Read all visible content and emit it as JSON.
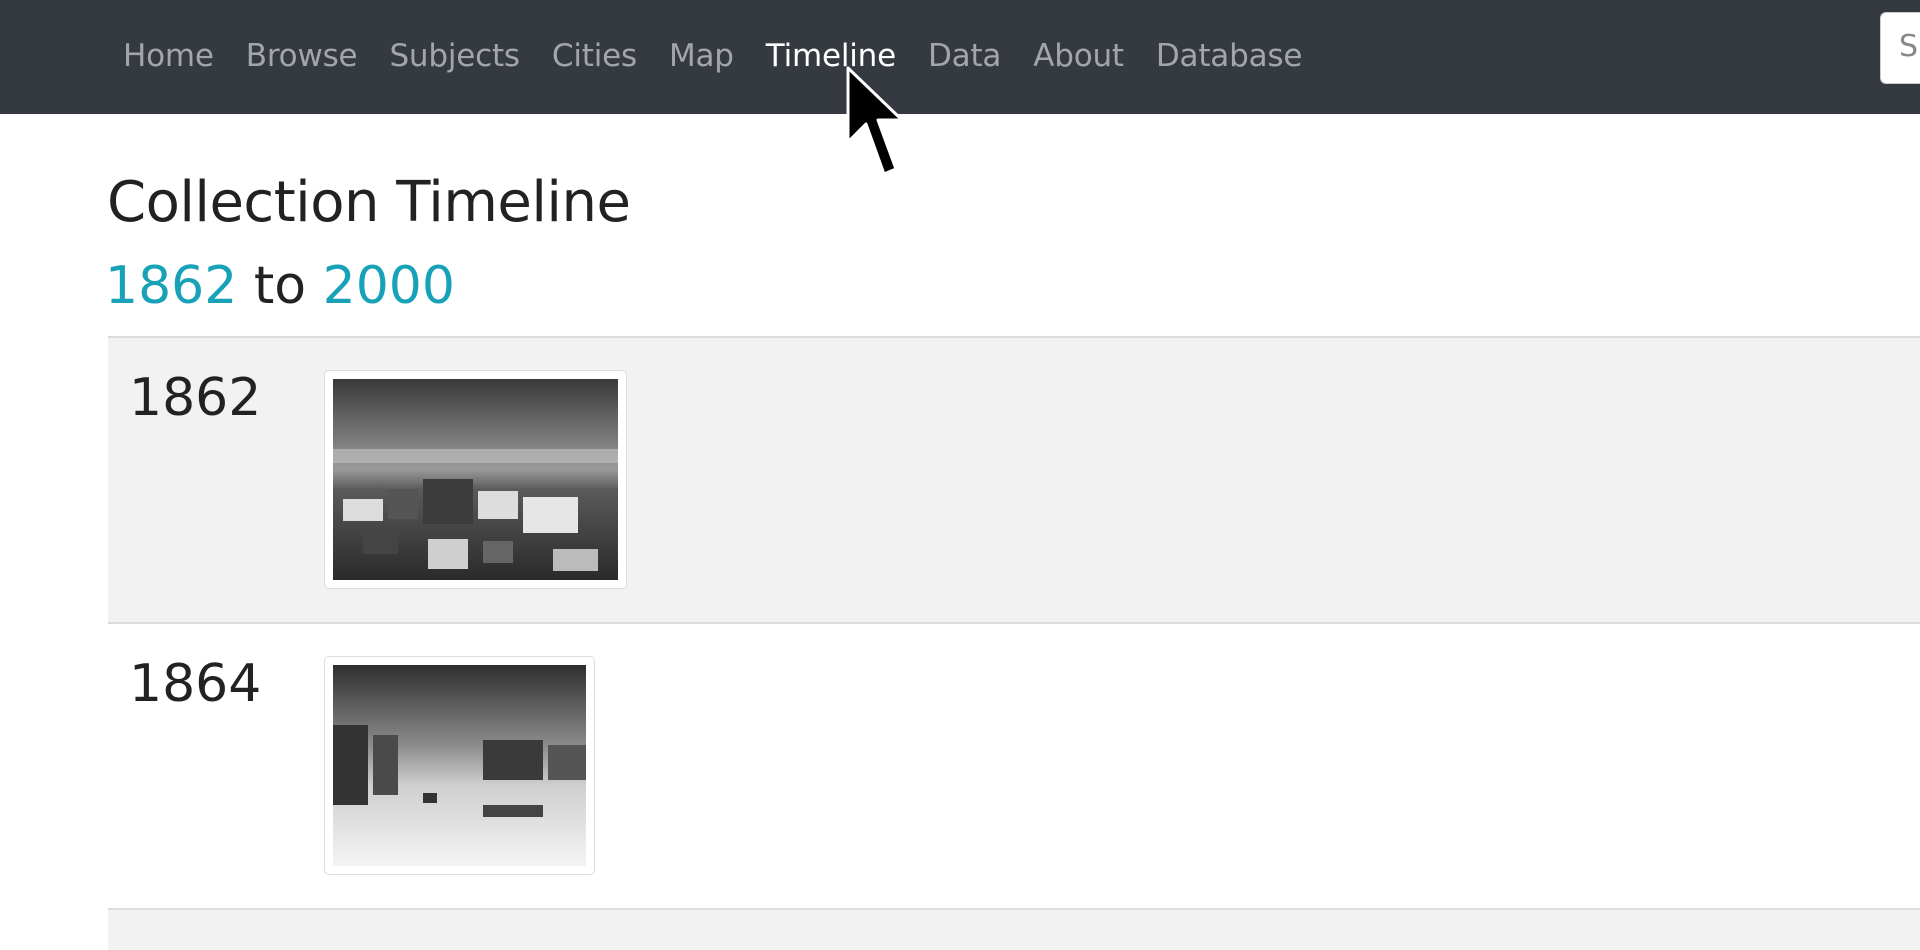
{
  "nav": {
    "items": [
      {
        "label": "Home"
      },
      {
        "label": "Browse"
      },
      {
        "label": "Subjects"
      },
      {
        "label": "Cities"
      },
      {
        "label": "Map"
      },
      {
        "label": "Timeline",
        "active": true
      },
      {
        "label": "Data"
      },
      {
        "label": "About"
      },
      {
        "label": "Database"
      }
    ],
    "search_placeholder": "S"
  },
  "page": {
    "title": "Collection Timeline",
    "range_start": "1862",
    "range_sep": "to",
    "range_end": "2000"
  },
  "timeline": [
    {
      "year": "1862",
      "image_icon": "historic-town-photo-icon"
    },
    {
      "year": "1864",
      "image_icon": "snowy-street-photo-icon"
    }
  ],
  "colors": {
    "navbar": "#343a40",
    "accent": "#17a2b8",
    "row_shaded": "#f2f2f2"
  }
}
